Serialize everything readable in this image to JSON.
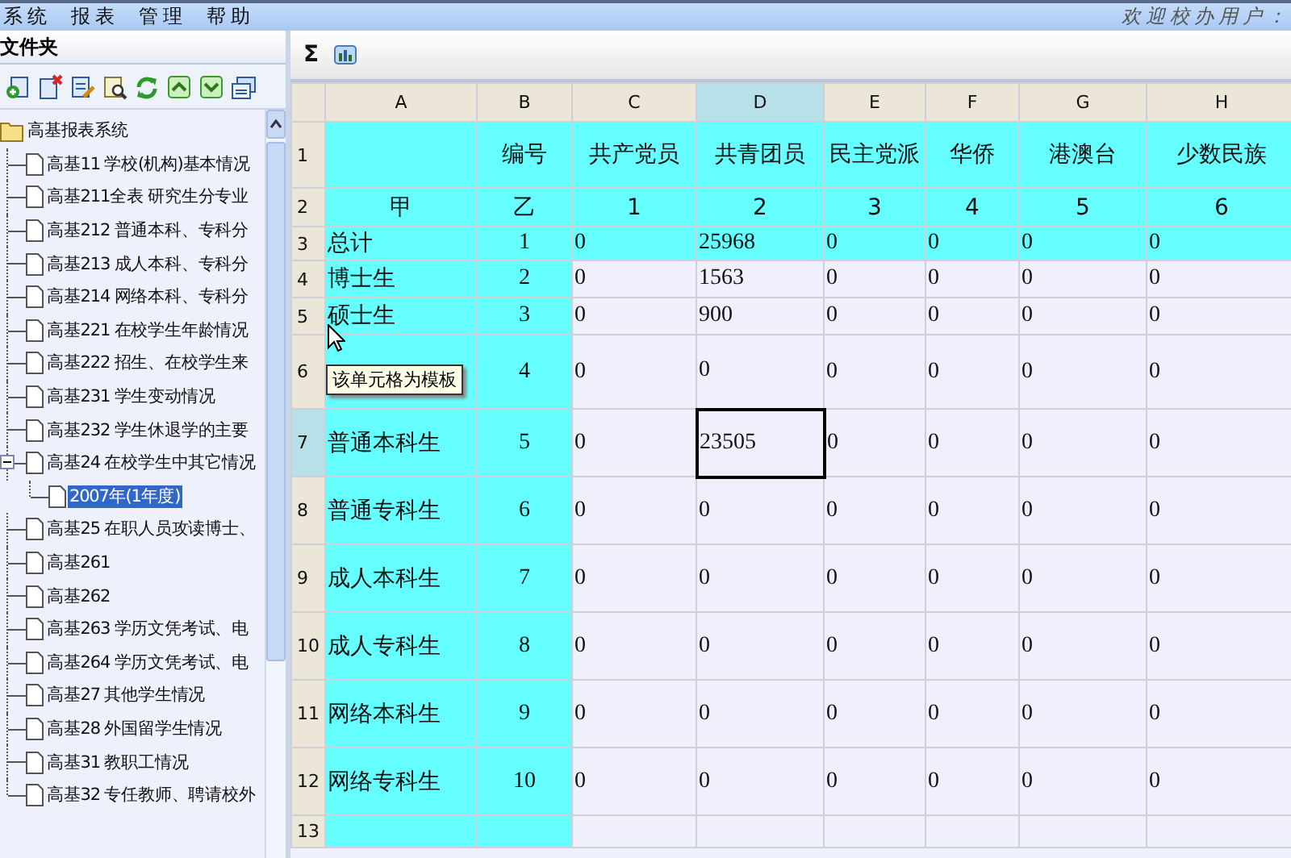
{
  "menu": [
    "系统",
    "报表",
    "管理",
    "帮助"
  ],
  "welcome": "欢迎校办用户：",
  "sidebar": {
    "title": "文件夹",
    "tree": [
      {
        "label": "高基报表系统",
        "selected": false,
        "children": [
          {
            "label": "高基11 学校(机构)基本情况",
            "selected": false
          },
          {
            "label": "高基211全表 研究生分专业",
            "selected": false
          },
          {
            "label": "高基212 普通本科、专科分",
            "selected": false
          },
          {
            "label": "高基213 成人本科、专科分",
            "selected": false
          },
          {
            "label": "高基214 网络本科、专科分",
            "selected": false
          },
          {
            "label": "高基221 在校学生年龄情况",
            "selected": false
          },
          {
            "label": "高基222 招生、在校学生来",
            "selected": false
          },
          {
            "label": "高基231 学生变动情况",
            "selected": false
          },
          {
            "label": "高基232 学生休退学的主要",
            "selected": false
          },
          {
            "label": "高基24 在校学生中其它情况",
            "selected": false,
            "expanded": true,
            "children": [
              {
                "label": "2007年(1年度)",
                "selected": true
              }
            ]
          },
          {
            "label": "高基25 在职人员攻读博士、",
            "selected": false
          },
          {
            "label": "高基261",
            "selected": false
          },
          {
            "label": "高基262",
            "selected": false
          },
          {
            "label": "高基263 学历文凭考试、电",
            "selected": false
          },
          {
            "label": "高基264 学历文凭考试、电",
            "selected": false
          },
          {
            "label": "高基27 其他学生情况",
            "selected": false
          },
          {
            "label": "高基28 外国留学生情况",
            "selected": false
          },
          {
            "label": "高基31 教职工情况",
            "selected": false
          },
          {
            "label": "高基32 专任教师、聘请校外",
            "selected": false
          }
        ]
      }
    ]
  },
  "toolbar": {
    "sum": "Σ"
  },
  "sheet": {
    "columns": [
      {
        "label": "A",
        "selected": false
      },
      {
        "label": "B",
        "selected": false
      },
      {
        "label": "C",
        "selected": false
      },
      {
        "label": "D",
        "selected": true
      },
      {
        "label": "E",
        "selected": false
      },
      {
        "label": "F",
        "selected": false
      },
      {
        "label": "G",
        "selected": false
      },
      {
        "label": "H",
        "selected": false
      }
    ],
    "rows": [
      {
        "number": "1",
        "kind": "header",
        "highlighted": true,
        "selected": false,
        "values": [
          "编号",
          "共产党员",
          "共青团员",
          "民主党派",
          "华侨",
          "港澳台",
          "少数民族"
        ]
      },
      {
        "number": "2",
        "kind": "header",
        "highlighted": true,
        "selected": false,
        "label": "甲",
        "values": [
          "乙",
          "1",
          "2",
          "3",
          "4",
          "5",
          "6"
        ]
      },
      {
        "number": "3",
        "kind": "data",
        "highlighted": true,
        "selected": false,
        "label": "总计",
        "values": [
          "1",
          "0",
          "25968",
          "0",
          "0",
          "0",
          "0"
        ]
      },
      {
        "number": "4",
        "kind": "data",
        "highlighted": false,
        "selected": false,
        "label": "博士生",
        "values": [
          "2",
          "0",
          "1563",
          "0",
          "0",
          "0",
          "0"
        ]
      },
      {
        "number": "5",
        "kind": "data",
        "highlighted": false,
        "selected": false,
        "label": "硕士生",
        "values": [
          "3",
          "0",
          "900",
          "0",
          "0",
          "0",
          "0"
        ]
      },
      {
        "number": "6",
        "kind": "data",
        "highlighted": false,
        "selected": false,
        "values": [
          "4",
          "0",
          "0",
          "0",
          "0",
          "0",
          "0"
        ]
      },
      {
        "number": "7",
        "kind": "data",
        "highlighted": false,
        "selected": true,
        "label": "普通本科生",
        "values": [
          "5",
          "0",
          "23505",
          "0",
          "0",
          "0",
          "0"
        ]
      },
      {
        "number": "8",
        "kind": "data",
        "highlighted": false,
        "selected": false,
        "label": "普通专科生",
        "values": [
          "6",
          "0",
          "0",
          "0",
          "0",
          "0",
          "0"
        ]
      },
      {
        "number": "9",
        "kind": "data",
        "highlighted": false,
        "selected": false,
        "label": "成人本科生",
        "values": [
          "7",
          "0",
          "0",
          "0",
          "0",
          "0",
          "0"
        ]
      },
      {
        "number": "10",
        "kind": "data",
        "highlighted": false,
        "selected": false,
        "label": "成人专科生",
        "values": [
          "8",
          "0",
          "0",
          "0",
          "0",
          "0",
          "0"
        ]
      },
      {
        "number": "11",
        "kind": "data",
        "highlighted": false,
        "selected": false,
        "label": "网络本科生",
        "values": [
          "9",
          "0",
          "0",
          "0",
          "0",
          "0",
          "0"
        ]
      },
      {
        "number": "12",
        "kind": "data",
        "highlighted": false,
        "selected": false,
        "label": "网络专科生",
        "values": [
          "10",
          "0",
          "0",
          "0",
          "0",
          "0",
          "0"
        ]
      },
      {
        "number": "13",
        "kind": "data",
        "highlighted": false,
        "selected": false
      }
    ],
    "tooltip": "该单元格为模板"
  }
}
